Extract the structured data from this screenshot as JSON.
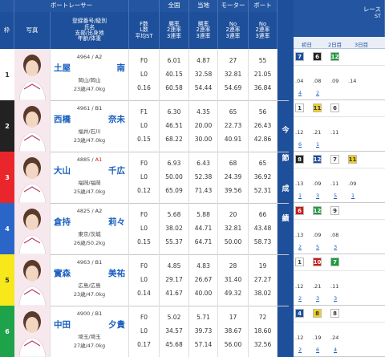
{
  "header": {
    "boat_racer": "ボートレーサー",
    "national": "全国",
    "local": "当地",
    "motor": "モーター",
    "boat": "ボート",
    "race_label": "レース"
  },
  "subheader": {
    "waku": "枠",
    "photo": "写真",
    "racer_cols": "登録番号/級別\n氏名\n支部/出身地\n年齢/体重",
    "flf": "F数\nL数\n平均ST",
    "national_rates": "勝率\n2連率\n3連率",
    "local_rates": "勝率\n2連率\n3連率",
    "motor_rates": "No\n2連率\n3連率",
    "boat_rates": "No\n2連率\n3連率",
    "day1": "初日",
    "day2": "2日目",
    "day3": "3日目",
    "st_label": "ST"
  },
  "konsetsu": [
    "今",
    "節",
    "成",
    "績"
  ],
  "racers": [
    {
      "waku": "1",
      "reg": "4964",
      "cls": "A2",
      "name1": "土屋",
      "name2": "南",
      "branch": "岡山/岡山",
      "age": "23歳/47.0kg",
      "f": "F0",
      "l": "L0",
      "st": "0.16",
      "n1": "6.01",
      "n2": "40.15",
      "n3": "60.58",
      "l1": "4.87",
      "l2": "32.58",
      "l3": "54.44",
      "m1": "27",
      "m2": "32.81",
      "m3": "54.69",
      "b1": "55",
      "b2": "21.05",
      "b3": "36.84",
      "results": [
        {
          "v": "7",
          "bg": "#1a4fa0",
          "fg": "#fff"
        },
        {
          "v": "6",
          "bg": "#222",
          "fg": "#fff"
        },
        {
          "v": "12",
          "bg": "#1b9c3c",
          "fg": "#fff"
        }
      ],
      "sts": [
        ".04",
        ".08",
        ".09",
        ".14"
      ],
      "links": [
        "4",
        "2"
      ]
    },
    {
      "waku": "2",
      "reg": "4961",
      "cls": "B1",
      "name1": "西橋",
      "name2": "奈未",
      "branch": "福井/石川",
      "age": "23歳/47.0kg",
      "f": "F1",
      "l": "L0",
      "st": "0.15",
      "n1": "6.30",
      "n2": "46.51",
      "n3": "68.22",
      "l1": "4.35",
      "l2": "20.00",
      "l3": "30.00",
      "m1": "65",
      "m2": "22.73",
      "m3": "40.91",
      "b1": "56",
      "b2": "26.43",
      "b3": "42.86",
      "results": [
        {
          "v": "1",
          "bg": "#fff",
          "fg": "#333"
        },
        {
          "v": "11",
          "bg": "#f0d020",
          "fg": "#333"
        },
        {
          "v": "6",
          "bg": "#fff",
          "fg": "#333"
        }
      ],
      "sts": [
        ".12",
        ".21",
        ".11"
      ],
      "links": [
        "6",
        "1"
      ]
    },
    {
      "waku": "3",
      "reg": "4885",
      "cls": "A1",
      "name1": "大山",
      "name2": "千広",
      "branch": "福岡/福岡",
      "age": "25歳/47.0kg",
      "f": "F0",
      "l": "L0",
      "st": "0.12",
      "n1": "6.93",
      "n2": "50.00",
      "n3": "65.09",
      "l1": "6.43",
      "l2": "52.38",
      "l3": "71.43",
      "m1": "68",
      "m2": "24.39",
      "m3": "39.56",
      "b1": "65",
      "b2": "36.92",
      "b3": "52.31",
      "results": [
        {
          "v": "8",
          "bg": "#222",
          "fg": "#fff"
        },
        {
          "v": "12",
          "bg": "#1a4fa0",
          "fg": "#fff"
        },
        {
          "v": "7",
          "bg": "#fff",
          "fg": "#333"
        },
        {
          "v": "11",
          "bg": "#f0d020",
          "fg": "#333"
        }
      ],
      "sts": [
        ".13",
        ".09",
        ".11",
        ".09"
      ],
      "links": [
        "1",
        "3",
        "5",
        "1"
      ]
    },
    {
      "waku": "4",
      "reg": "4825",
      "cls": "A2",
      "name1": "倉持",
      "name2": "莉々",
      "branch": "東京/茨城",
      "age": "26歳/50.2kg",
      "f": "F0",
      "l": "L0",
      "st": "0.15",
      "n1": "5.68",
      "n2": "38.02",
      "n3": "55.37",
      "l1": "5.88",
      "l2": "44.71",
      "l3": "64.71",
      "m1": "20",
      "m2": "32.81",
      "m3": "50.00",
      "b1": "66",
      "b2": "43.48",
      "b3": "58.73",
      "results": [
        {
          "v": "6",
          "bg": "#d01818",
          "fg": "#fff"
        },
        {
          "v": "12",
          "bg": "#1b9c3c",
          "fg": "#fff"
        },
        {
          "v": "9",
          "bg": "#fff",
          "fg": "#333"
        }
      ],
      "sts": [
        ".13",
        ".09",
        ".08"
      ],
      "links": [
        "2",
        "5",
        "3"
      ]
    },
    {
      "waku": "5",
      "reg": "4963",
      "cls": "B1",
      "name1": "實森",
      "name2": "美祐",
      "branch": "広島/広島",
      "age": "23歳/47.0kg",
      "f": "F0",
      "l": "L0",
      "st": "0.14",
      "n1": "4.85",
      "n2": "29.17",
      "n3": "41.67",
      "l1": "4.83",
      "l2": "26.67",
      "l3": "40.00",
      "m1": "28",
      "m2": "31.40",
      "m3": "49.32",
      "b1": "19",
      "b2": "27.27",
      "b3": "38.02",
      "results": [
        {
          "v": "1",
          "bg": "#fff",
          "fg": "#333"
        },
        {
          "v": "10",
          "bg": "#d01818",
          "fg": "#fff"
        },
        {
          "v": "7",
          "bg": "#1b9c3c",
          "fg": "#fff"
        }
      ],
      "sts": [
        ".12",
        ".21",
        ".11"
      ],
      "links": [
        "2",
        "3",
        "3"
      ]
    },
    {
      "waku": "6",
      "reg": "4900",
      "cls": "B1",
      "name1": "中田",
      "name2": "夕貴",
      "branch": "埼玉/埼玉",
      "age": "27歳/47.0kg",
      "f": "F0",
      "l": "L0",
      "st": "0.17",
      "n1": "5.02",
      "n2": "34.57",
      "n3": "45.68",
      "l1": "5.71",
      "l2": "39.73",
      "l3": "57.14",
      "m1": "17",
      "m2": "38.67",
      "m3": "56.00",
      "b1": "72",
      "b2": "18.60",
      "b3": "32.56",
      "results": [
        {
          "v": "4",
          "bg": "#1a4fa0",
          "fg": "#fff"
        },
        {
          "v": "8",
          "bg": "#f0d020",
          "fg": "#333"
        },
        {
          "v": "8",
          "bg": "#fff",
          "fg": "#333"
        }
      ],
      "sts": [
        ".12",
        ".19",
        ".24"
      ],
      "links": [
        "2",
        "6",
        "4"
      ]
    }
  ],
  "colors": {
    "header_blue": "#2355a0",
    "waku1": "#ffffff",
    "waku2": "#222222",
    "waku3": "#e8262b",
    "waku4": "#2a66c8",
    "waku5": "#f6e81a",
    "waku6": "#1ea24a",
    "name_link": "#1a5fc0",
    "a1_red": "#d01818"
  }
}
